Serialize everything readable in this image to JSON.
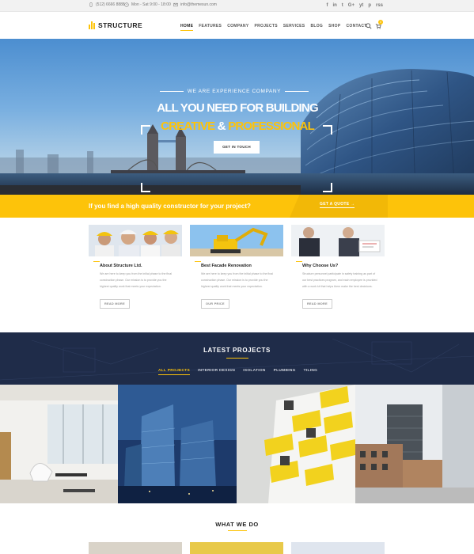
{
  "topbar": {
    "phone": "(512) 6666 8888",
    "hours": "Mon - Sat 9:00 - 18:00",
    "email": "info@themesun.com",
    "social": [
      "f",
      "in",
      "t",
      "G+",
      "yt",
      "p",
      "rss"
    ]
  },
  "header": {
    "logo": "STRUCTURE",
    "nav": [
      "HOME",
      "FEATURES",
      "COMPANY",
      "PROJECTS",
      "SERVICES",
      "BLOG",
      "SHOP",
      "CONTACT"
    ],
    "cart_count": "0"
  },
  "hero": {
    "kicker": "WE ARE EXPERIENCE COMPANY",
    "title_line1": "ALL YOU NEED FOR BUILDING",
    "title_creative": "CREATIVE",
    "title_amp": " & ",
    "title_professional": "PROFESSIONAL",
    "button": "GET IN TOUCH"
  },
  "quote_bar": {
    "text": "If you find a high quality constructor for your project?",
    "button": "GET A QUOTE"
  },
  "features": [
    {
      "title": "About Structure Ltd.",
      "text": "We are here to keep you from the initial phase to the final construction phase. Our mission is to provide you the highest quality work that meets your expectation.",
      "button": "READ MORE"
    },
    {
      "title": "Best Facade Renovation",
      "text": "We are here to keep you from the initial phase to the final construction phase. Our mission is to provide you the highest quality work that meets your expectation.",
      "button": "OUR PRICE"
    },
    {
      "title": "Why Choose Us?",
      "text": "Structure personnel participate in safety training as part of our best practices program, and each employee is provided with a work kit that helps them make the best decisions.",
      "button": "READ MORE"
    }
  ],
  "projects": {
    "title": "LATEST PROJECTS",
    "filters": [
      "ALL PROJECTS",
      "INTERIOR DESIGN",
      "ISOLATION",
      "PLUMBING",
      "TILING"
    ]
  },
  "what_we_do": {
    "title": "WHAT WE DO"
  },
  "colors": {
    "accent": "#fdc30a",
    "navy": "#1f2c49"
  }
}
